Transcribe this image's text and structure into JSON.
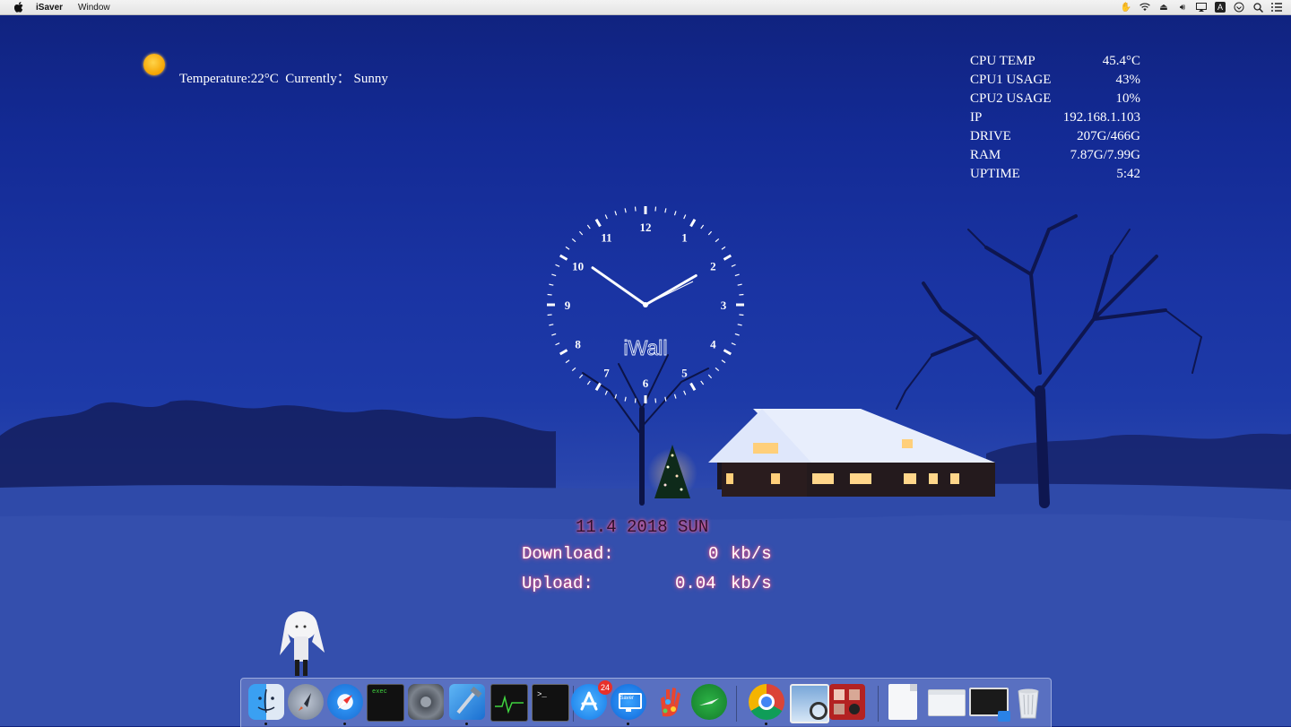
{
  "menubar": {
    "app_name": "iSaver",
    "menus": [
      "Window"
    ],
    "tray_icons": [
      "hand-icon",
      "wifi-icon",
      "eject-icon",
      "volume-icon",
      "airplay-icon",
      "input-source-icon",
      "spark-icon",
      "spotlight-icon",
      "notification-center-icon"
    ],
    "input_source_label": "A"
  },
  "weather": {
    "text": "Temperature:22°C  Currently： Sunny",
    "icon": "sun-icon"
  },
  "stats": [
    {
      "label": "CPU TEMP",
      "value": "45.4°C"
    },
    {
      "label": "CPU1 USAGE",
      "value": "43%"
    },
    {
      "label": "CPU2 USAGE",
      "value": "10%"
    },
    {
      "label": "IP",
      "value": "192.168.1.103"
    },
    {
      "label": "DRIVE",
      "value": "207G/466G"
    },
    {
      "label": "RAM",
      "value": "7.87G/7.99G"
    },
    {
      "label": "UPTIME",
      "value": "5:42"
    }
  ],
  "clock": {
    "numbers": [
      "12",
      "1",
      "2",
      "3",
      "4",
      "5",
      "6",
      "7",
      "8",
      "9",
      "10",
      "11"
    ],
    "brand": "iWall",
    "time": "10:10"
  },
  "date_line": "11.4  2018  SUN",
  "network": {
    "download_label": "Download:",
    "download_value": "0",
    "upload_label": "Upload:",
    "upload_value": "0.04",
    "unit": "kb/s"
  },
  "dock": {
    "apps": [
      {
        "name": "finder-icon",
        "running": true
      },
      {
        "name": "launchpad-icon",
        "running": false
      },
      {
        "name": "safari-icon",
        "running": true
      },
      {
        "name": "exec-terminal-icon",
        "running": false,
        "label": "exec"
      },
      {
        "name": "system-preferences-icon",
        "running": false
      },
      {
        "name": "xcode-icon",
        "running": true
      },
      {
        "name": "activity-monitor-icon",
        "running": false
      },
      {
        "name": "terminal-icon",
        "running": false
      },
      {
        "name": "app-store-icon",
        "running": false,
        "badge": "24"
      },
      {
        "name": "isaver-icon",
        "running": true,
        "label": "iSaver"
      },
      {
        "name": "paint-hand-icon",
        "running": false
      },
      {
        "name": "green-plane-icon",
        "running": false
      },
      {
        "name": "chrome-icon",
        "running": true
      },
      {
        "name": "preview-icon",
        "running": false
      },
      {
        "name": "photo-booth-icon",
        "running": false
      },
      {
        "name": "document-icon",
        "running": false
      },
      {
        "name": "window-icon",
        "running": false
      },
      {
        "name": "screen-sharing-icon",
        "running": false
      },
      {
        "name": "trash-icon",
        "running": false
      }
    ]
  }
}
